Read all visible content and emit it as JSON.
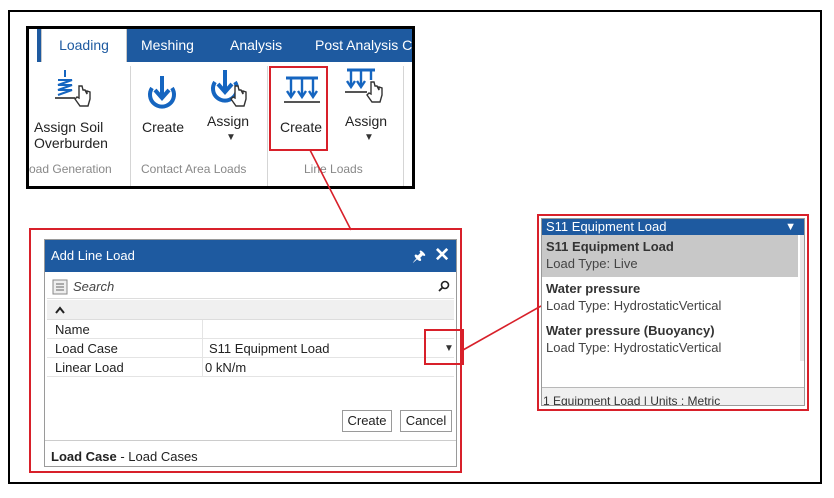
{
  "ribbon": {
    "tabs": [
      "Loading",
      "Meshing",
      "Analysis",
      "Post Analysis C"
    ],
    "buttons": {
      "assign_soil": [
        "Assign Soil",
        "Overburden"
      ],
      "contact_create": "Create",
      "contact_assign": "Assign",
      "line_create": "Create",
      "line_assign": "Assign"
    },
    "groups": [
      "oad Generation",
      "Contact Area Loads",
      "Line Loads"
    ]
  },
  "dialog": {
    "title": "Add Line Load",
    "search_placeholder": "Search",
    "properties": [
      {
        "name": "Name",
        "value": ""
      },
      {
        "name": "Load Case",
        "value": "S11 Equipment Load"
      },
      {
        "name": "Linear Load",
        "value": "0 kN/m"
      }
    ],
    "create_label": "Create",
    "cancel_label": "Cancel",
    "footer_bold": "Load Case",
    "footer_rest": " - Load Cases"
  },
  "dropdown": {
    "selected": "S11 Equipment Load",
    "items": [
      {
        "title": "S11 Equipment Load",
        "subtitle": "Load Type: Live"
      },
      {
        "title": "Water pressure",
        "subtitle": "Load Type: HydrostaticVertical"
      },
      {
        "title": "Water pressure (Buoyancy)",
        "subtitle": "Load Type: HydrostaticVertical"
      }
    ],
    "status_text": "1 Equipment Load  |  Units : Metric"
  },
  "colors": {
    "brand_blue": "#1e5aa0",
    "callout_red": "#d8202a",
    "icon_blue": "#1565c0"
  }
}
